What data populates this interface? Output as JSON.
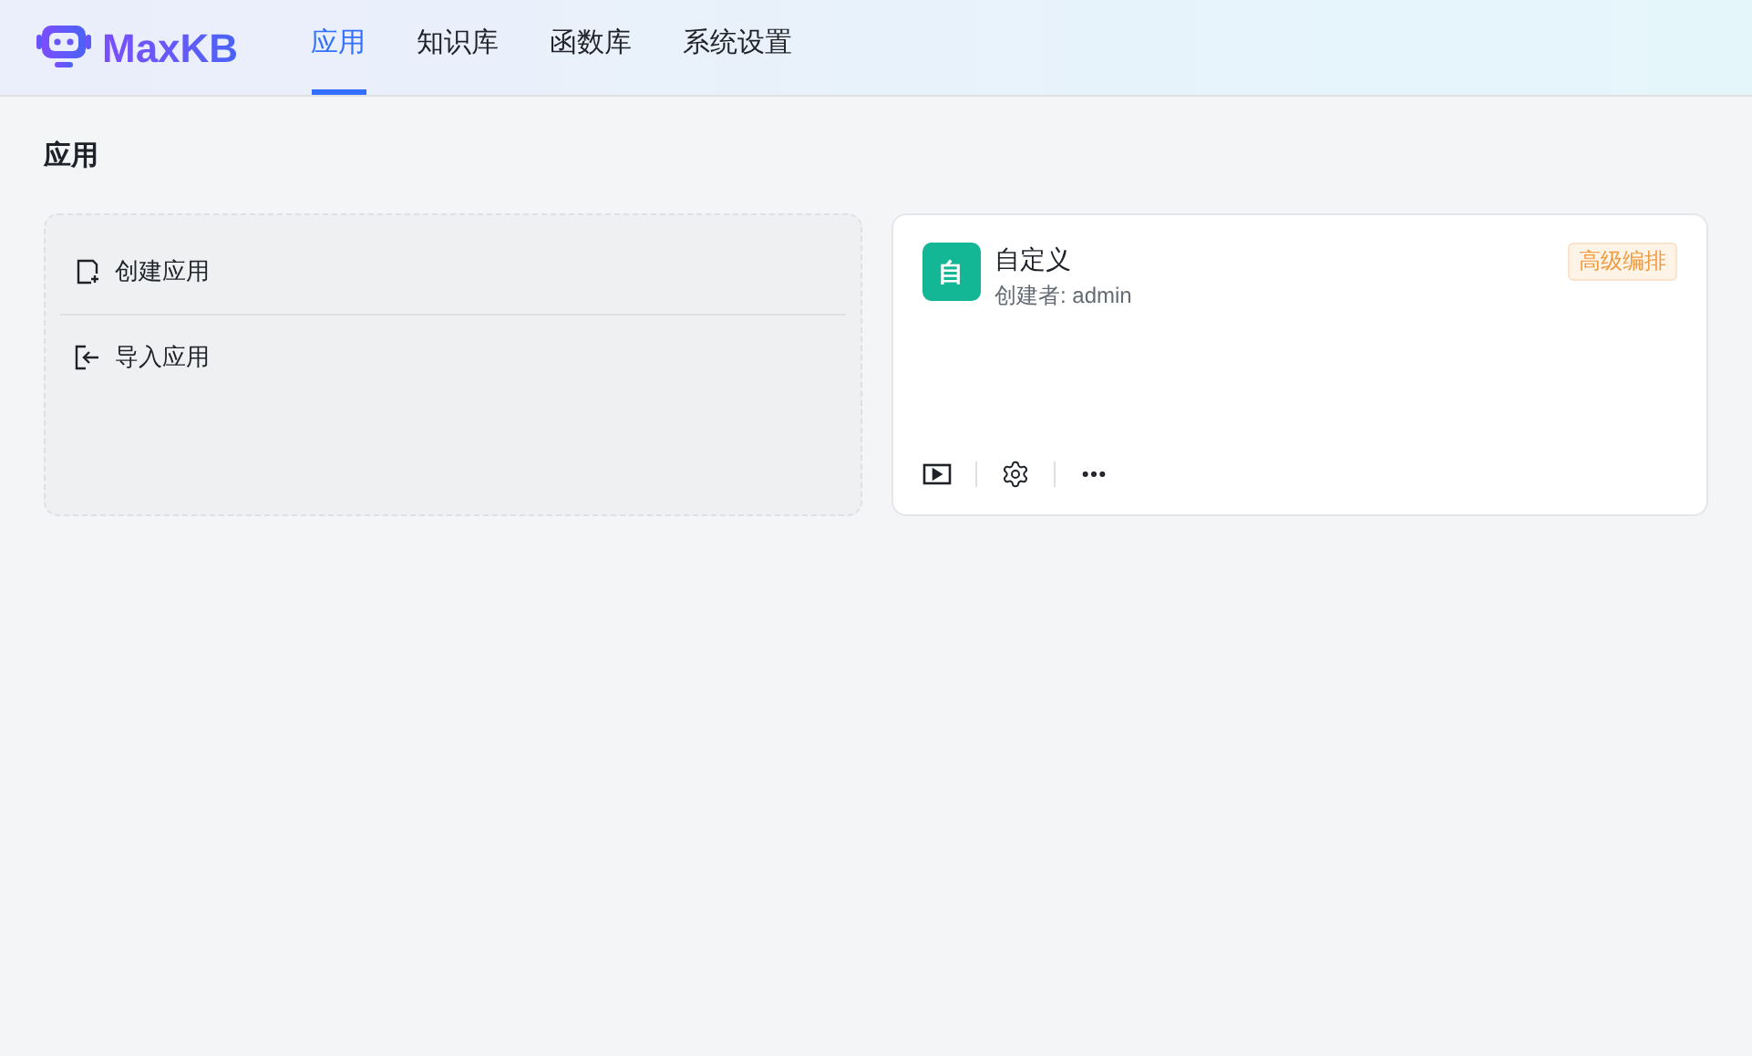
{
  "header": {
    "logo_text": "MaxKB",
    "tabs": [
      {
        "label": "应用",
        "selected": true
      },
      {
        "label": "知识库",
        "selected": false
      },
      {
        "label": "函数库",
        "selected": false
      },
      {
        "label": "系统设置",
        "selected": false
      }
    ]
  },
  "page_title": "应用",
  "create_card": {
    "actions": [
      {
        "kind": "create",
        "label": "创建应用"
      },
      {
        "kind": "import",
        "label": "导入应用"
      }
    ]
  },
  "apps": [
    {
      "avatar": "自",
      "name": "自定义",
      "creator": "创建者: admin",
      "tag": "高级编排"
    }
  ]
}
